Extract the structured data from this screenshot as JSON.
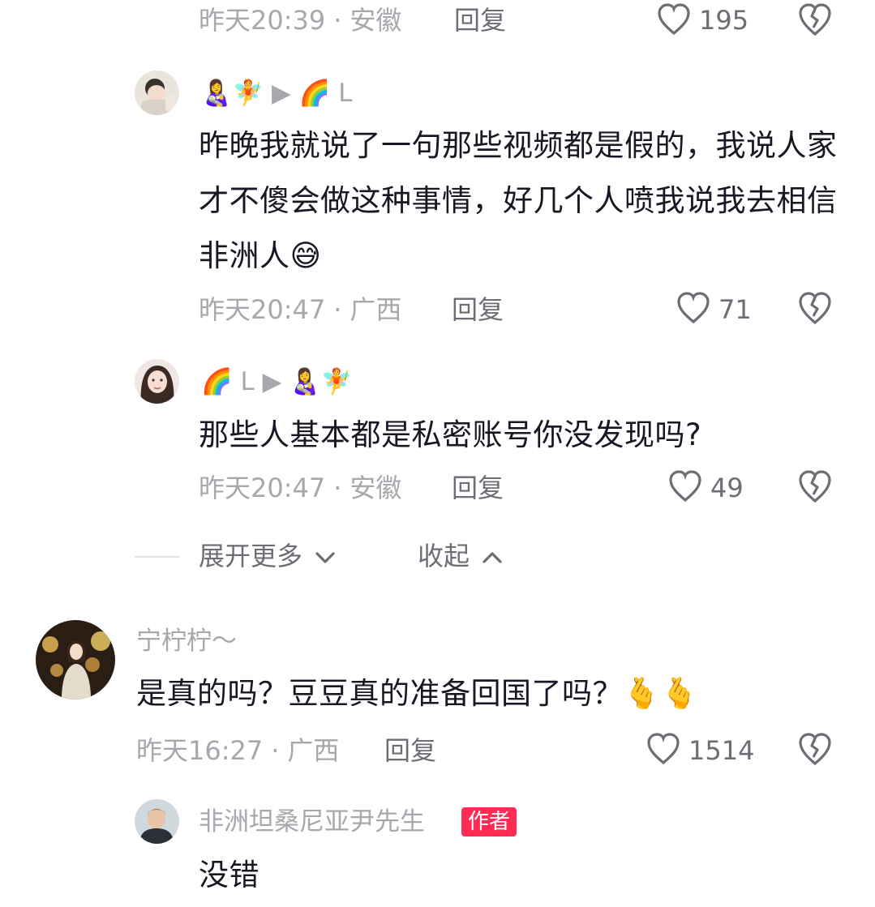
{
  "comments": [
    {
      "time": "昨天20:39",
      "location": "安徽",
      "reply_label": "回复",
      "likes": "195"
    },
    {
      "name": "👩‍🍼🧚 ▶ 🌈 L",
      "text": "昨晚我就说了一句那些视频都是假的，我说人家才不傻会做这种事情，好几个人喷我说我去相信非洲人😅",
      "time": "昨天20:47",
      "location": "广西",
      "reply_label": "回复",
      "likes": "71"
    },
    {
      "name": "🌈 L ▶ 👩‍🍼🧚",
      "text": "那些人基本都是私密账号你没发现吗?",
      "time": "昨天20:47",
      "location": "安徽",
      "reply_label": "回复",
      "likes": "49"
    },
    {
      "name": "宁柠柠～",
      "text": "是真的吗？豆豆真的准备回国了吗？🫰🫰",
      "time": "昨天16:27",
      "location": "广西",
      "reply_label": "回复",
      "likes": "1514"
    },
    {
      "name": "非洲坦桑尼亚尹先生",
      "badge": "作者",
      "text": "没错"
    }
  ],
  "thread_controls": {
    "expand_label": "展开更多",
    "collapse_label": "收起"
  },
  "colors": {
    "text": "#161823",
    "muted": "#a6a8ad",
    "secondary": "#6b6e75",
    "author_badge": "#fe2c55"
  },
  "icons": [
    "heart-icon",
    "dislike-icon",
    "chevron-down-icon",
    "chevron-up-icon"
  ]
}
